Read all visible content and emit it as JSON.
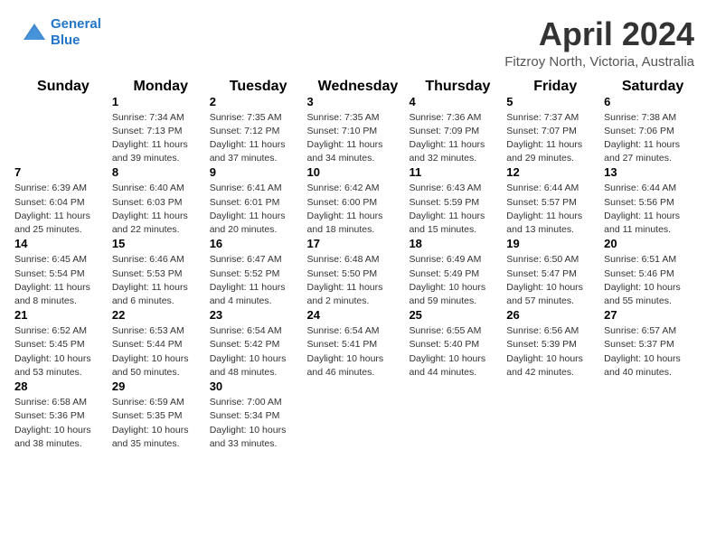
{
  "header": {
    "logo_line1": "General",
    "logo_line2": "Blue",
    "month_title": "April 2024",
    "location": "Fitzroy North, Victoria, Australia"
  },
  "days_of_week": [
    "Sunday",
    "Monday",
    "Tuesday",
    "Wednesday",
    "Thursday",
    "Friday",
    "Saturday"
  ],
  "weeks": [
    [
      {
        "day": "",
        "info": ""
      },
      {
        "day": "1",
        "info": "Sunrise: 7:34 AM\nSunset: 7:13 PM\nDaylight: 11 hours\nand 39 minutes."
      },
      {
        "day": "2",
        "info": "Sunrise: 7:35 AM\nSunset: 7:12 PM\nDaylight: 11 hours\nand 37 minutes."
      },
      {
        "day": "3",
        "info": "Sunrise: 7:35 AM\nSunset: 7:10 PM\nDaylight: 11 hours\nand 34 minutes."
      },
      {
        "day": "4",
        "info": "Sunrise: 7:36 AM\nSunset: 7:09 PM\nDaylight: 11 hours\nand 32 minutes."
      },
      {
        "day": "5",
        "info": "Sunrise: 7:37 AM\nSunset: 7:07 PM\nDaylight: 11 hours\nand 29 minutes."
      },
      {
        "day": "6",
        "info": "Sunrise: 7:38 AM\nSunset: 7:06 PM\nDaylight: 11 hours\nand 27 minutes."
      }
    ],
    [
      {
        "day": "7",
        "info": "Sunrise: 6:39 AM\nSunset: 6:04 PM\nDaylight: 11 hours\nand 25 minutes."
      },
      {
        "day": "8",
        "info": "Sunrise: 6:40 AM\nSunset: 6:03 PM\nDaylight: 11 hours\nand 22 minutes."
      },
      {
        "day": "9",
        "info": "Sunrise: 6:41 AM\nSunset: 6:01 PM\nDaylight: 11 hours\nand 20 minutes."
      },
      {
        "day": "10",
        "info": "Sunrise: 6:42 AM\nSunset: 6:00 PM\nDaylight: 11 hours\nand 18 minutes."
      },
      {
        "day": "11",
        "info": "Sunrise: 6:43 AM\nSunset: 5:59 PM\nDaylight: 11 hours\nand 15 minutes."
      },
      {
        "day": "12",
        "info": "Sunrise: 6:44 AM\nSunset: 5:57 PM\nDaylight: 11 hours\nand 13 minutes."
      },
      {
        "day": "13",
        "info": "Sunrise: 6:44 AM\nSunset: 5:56 PM\nDaylight: 11 hours\nand 11 minutes."
      }
    ],
    [
      {
        "day": "14",
        "info": "Sunrise: 6:45 AM\nSunset: 5:54 PM\nDaylight: 11 hours\nand 8 minutes."
      },
      {
        "day": "15",
        "info": "Sunrise: 6:46 AM\nSunset: 5:53 PM\nDaylight: 11 hours\nand 6 minutes."
      },
      {
        "day": "16",
        "info": "Sunrise: 6:47 AM\nSunset: 5:52 PM\nDaylight: 11 hours\nand 4 minutes."
      },
      {
        "day": "17",
        "info": "Sunrise: 6:48 AM\nSunset: 5:50 PM\nDaylight: 11 hours\nand 2 minutes."
      },
      {
        "day": "18",
        "info": "Sunrise: 6:49 AM\nSunset: 5:49 PM\nDaylight: 10 hours\nand 59 minutes."
      },
      {
        "day": "19",
        "info": "Sunrise: 6:50 AM\nSunset: 5:47 PM\nDaylight: 10 hours\nand 57 minutes."
      },
      {
        "day": "20",
        "info": "Sunrise: 6:51 AM\nSunset: 5:46 PM\nDaylight: 10 hours\nand 55 minutes."
      }
    ],
    [
      {
        "day": "21",
        "info": "Sunrise: 6:52 AM\nSunset: 5:45 PM\nDaylight: 10 hours\nand 53 minutes."
      },
      {
        "day": "22",
        "info": "Sunrise: 6:53 AM\nSunset: 5:44 PM\nDaylight: 10 hours\nand 50 minutes."
      },
      {
        "day": "23",
        "info": "Sunrise: 6:54 AM\nSunset: 5:42 PM\nDaylight: 10 hours\nand 48 minutes."
      },
      {
        "day": "24",
        "info": "Sunrise: 6:54 AM\nSunset: 5:41 PM\nDaylight: 10 hours\nand 46 minutes."
      },
      {
        "day": "25",
        "info": "Sunrise: 6:55 AM\nSunset: 5:40 PM\nDaylight: 10 hours\nand 44 minutes."
      },
      {
        "day": "26",
        "info": "Sunrise: 6:56 AM\nSunset: 5:39 PM\nDaylight: 10 hours\nand 42 minutes."
      },
      {
        "day": "27",
        "info": "Sunrise: 6:57 AM\nSunset: 5:37 PM\nDaylight: 10 hours\nand 40 minutes."
      }
    ],
    [
      {
        "day": "28",
        "info": "Sunrise: 6:58 AM\nSunset: 5:36 PM\nDaylight: 10 hours\nand 38 minutes."
      },
      {
        "day": "29",
        "info": "Sunrise: 6:59 AM\nSunset: 5:35 PM\nDaylight: 10 hours\nand 35 minutes."
      },
      {
        "day": "30",
        "info": "Sunrise: 7:00 AM\nSunset: 5:34 PM\nDaylight: 10 hours\nand 33 minutes."
      },
      {
        "day": "",
        "info": ""
      },
      {
        "day": "",
        "info": ""
      },
      {
        "day": "",
        "info": ""
      },
      {
        "day": "",
        "info": ""
      }
    ]
  ]
}
